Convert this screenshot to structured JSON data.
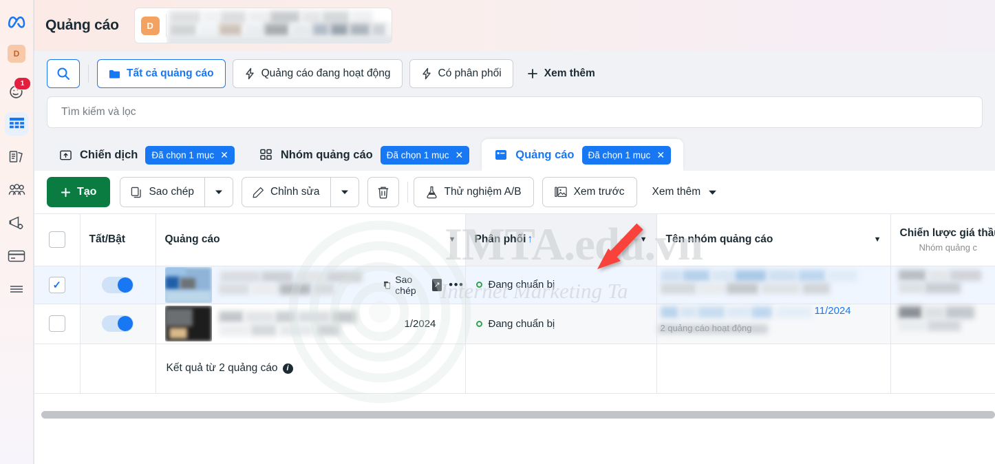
{
  "brand": {
    "logo_icon": "meta-infinity-logo",
    "account_initial": "D"
  },
  "rail": {
    "items": [
      {
        "name": "account-avatar",
        "label": "D",
        "icon": "avatar-initial"
      },
      {
        "name": "notifications",
        "label": "",
        "icon": "bell-face-icon",
        "badge": "1"
      },
      {
        "name": "ads-manager",
        "label": "",
        "icon": "table-grid-icon",
        "active": true
      },
      {
        "name": "pages",
        "label": "",
        "icon": "documents-icon"
      },
      {
        "name": "audiences",
        "label": "",
        "icon": "people-group-icon"
      },
      {
        "name": "campaigns",
        "label": "",
        "icon": "megaphone-icon"
      },
      {
        "name": "billing",
        "label": "",
        "icon": "credit-card-icon"
      },
      {
        "name": "more-menu",
        "label": "",
        "icon": "hamburger-menu-icon"
      }
    ]
  },
  "header": {
    "title": "Quảng cáo",
    "account_initial": "D",
    "account_name_redacted": true
  },
  "filters": {
    "search_icon": "magnifier-icon",
    "buttons": [
      {
        "name": "all-ads",
        "label": "Tất cả quảng cáo",
        "icon": "folder-icon",
        "selected": true
      },
      {
        "name": "active-ads",
        "label": "Quảng cáo đang hoạt động",
        "icon": "bolt-icon",
        "selected": false
      },
      {
        "name": "delivering",
        "label": "Có phân phối",
        "icon": "bolt-icon",
        "selected": false
      }
    ],
    "more": {
      "label": "Xem thêm",
      "icon": "plus-icon"
    }
  },
  "search": {
    "placeholder": "Tìm kiếm và lọc",
    "value": ""
  },
  "tabs": [
    {
      "name": "tab-campaign",
      "label": "Chiến dịch",
      "icon": "campaign-folder-icon",
      "chip": "Đã chọn 1 mục",
      "active": false
    },
    {
      "name": "tab-adset",
      "label": "Nhóm quảng cáo",
      "icon": "adset-squares-icon",
      "chip": "Đã chọn 1 mục",
      "active": false
    },
    {
      "name": "tab-ad",
      "label": "Quảng cáo",
      "icon": "ad-card-icon",
      "chip": "Đã chọn 1 mục",
      "active": true
    }
  ],
  "toolbar": {
    "create": {
      "label": "Tạo",
      "icon": "plus-icon"
    },
    "duplicate": {
      "label": "Sao chép",
      "icon": "copy-icon"
    },
    "edit": {
      "label": "Chỉnh sửa",
      "icon": "pencil-icon"
    },
    "delete": {
      "label": "",
      "icon": "trash-icon"
    },
    "ab_test": {
      "label": "Thử nghiệm A/B",
      "icon": "flask-icon"
    },
    "preview": {
      "label": "Xem trước",
      "icon": "image-preview-icon"
    },
    "more": {
      "label": "Xem thêm",
      "icon": "caret-down-icon"
    }
  },
  "table": {
    "columns": [
      {
        "name": "col-select",
        "label": "",
        "type": "checkbox"
      },
      {
        "name": "col-toggle",
        "label": "Tất/Bật"
      },
      {
        "name": "col-ad",
        "label": "Quảng cáo",
        "has_caret": true
      },
      {
        "name": "col-delivery",
        "label": "Phân phối",
        "sorted": "asc",
        "sort_icon": "arrow-up-icon",
        "has_caret": true,
        "shaded": true
      },
      {
        "name": "col-adset-name",
        "label": "Tên nhóm quảng cáo",
        "has_caret": true
      },
      {
        "name": "col-bid-strategy",
        "label": "Chiến lược giá thầu",
        "sub": "Nhóm quảng c"
      }
    ],
    "rows": [
      {
        "name": "ad-row-1",
        "selected": true,
        "toggle_on": true,
        "ad_name_redacted": true,
        "inline_actions": [
          {
            "name": "row-duplicate",
            "label": "Sao chép",
            "icon": "copy-icon"
          },
          {
            "name": "row-open",
            "label": "",
            "icon": "open-external-icon"
          },
          {
            "name": "row-more",
            "label": "…",
            "icon": "ellipsis-icon"
          }
        ],
        "delivery": "Đang chuẩn bị",
        "delivery_status_color": "#31a24c",
        "adset_name_redacted": true,
        "adset_sub": "2 quảng cáo hoạt động",
        "bid_redacted": true
      },
      {
        "name": "ad-row-2",
        "selected": false,
        "toggle_on": true,
        "ad_name_redacted": true,
        "ad_date": "1/2024",
        "delivery": "Đang chuẩn bị",
        "delivery_status_color": "#31a24c",
        "adset_name_redacted": true,
        "adset_date": "11/2024",
        "adset_sub": "2 quảng cáo hoạt động",
        "bid_redacted": true
      }
    ],
    "summary": {
      "label": "Kết quả từ 2 quảng cáo",
      "info_icon": "info-icon"
    }
  },
  "watermark": {
    "main": "IMTA.edu.vn",
    "sub": "Internet Marketing Ta"
  },
  "annotation": {
    "type": "red-arrow",
    "points_to": "col-delivery"
  },
  "colors": {
    "accent_blue": "#1877f2",
    "green": "#0a7c42",
    "status_green": "#31a24c",
    "badge_red": "#e41e3f",
    "avatar_orange": "#f4a261"
  }
}
